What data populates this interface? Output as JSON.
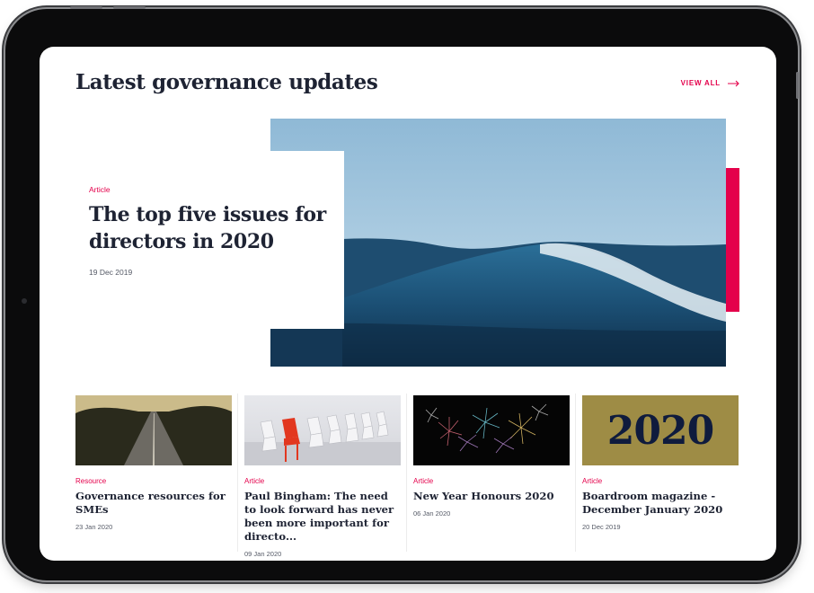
{
  "header": {
    "title": "Latest governance updates",
    "view_all": "VIEW ALL"
  },
  "hero": {
    "tag": "Article",
    "title_line1": "The top five issues for",
    "title_line2": "directors in 2020",
    "date": "19 Dec 2019"
  },
  "cards": [
    {
      "tag": "Resource",
      "title": "Governance resources for SMEs",
      "date": "23 Jan 2020"
    },
    {
      "tag": "Article",
      "title": "Paul Bingham: The need to look forward has never been more important for directo...",
      "date": "09 Jan 2020"
    },
    {
      "tag": "Article",
      "title": "New Year Honours 2020",
      "date": "06 Jan 2020"
    },
    {
      "tag": "Article",
      "title": "Boardroom magazine - December January 2020",
      "date": "20 Dec 2019",
      "image_text": "2020"
    }
  ],
  "colors": {
    "accent": "#e4004b",
    "heading": "#1e2333",
    "gold": "#9e8c45",
    "navy": "#0f1b3d"
  },
  "icons": {
    "view_all": "arrow-right-icon"
  }
}
